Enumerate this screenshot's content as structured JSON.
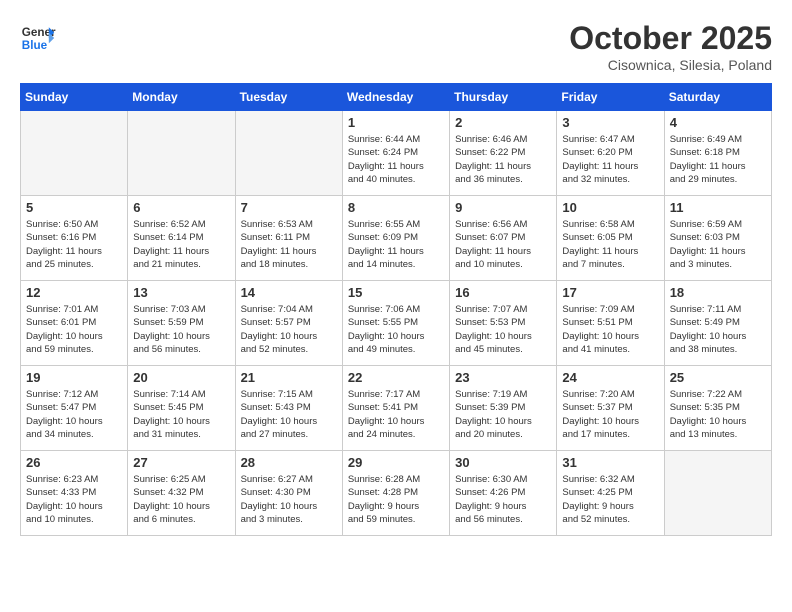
{
  "header": {
    "logo_line1": "General",
    "logo_line2": "Blue",
    "month": "October 2025",
    "location": "Cisownica, Silesia, Poland"
  },
  "days_of_week": [
    "Sunday",
    "Monday",
    "Tuesday",
    "Wednesday",
    "Thursday",
    "Friday",
    "Saturday"
  ],
  "weeks": [
    [
      {
        "day": "",
        "info": ""
      },
      {
        "day": "",
        "info": ""
      },
      {
        "day": "",
        "info": ""
      },
      {
        "day": "1",
        "info": "Sunrise: 6:44 AM\nSunset: 6:24 PM\nDaylight: 11 hours\nand 40 minutes."
      },
      {
        "day": "2",
        "info": "Sunrise: 6:46 AM\nSunset: 6:22 PM\nDaylight: 11 hours\nand 36 minutes."
      },
      {
        "day": "3",
        "info": "Sunrise: 6:47 AM\nSunset: 6:20 PM\nDaylight: 11 hours\nand 32 minutes."
      },
      {
        "day": "4",
        "info": "Sunrise: 6:49 AM\nSunset: 6:18 PM\nDaylight: 11 hours\nand 29 minutes."
      }
    ],
    [
      {
        "day": "5",
        "info": "Sunrise: 6:50 AM\nSunset: 6:16 PM\nDaylight: 11 hours\nand 25 minutes."
      },
      {
        "day": "6",
        "info": "Sunrise: 6:52 AM\nSunset: 6:14 PM\nDaylight: 11 hours\nand 21 minutes."
      },
      {
        "day": "7",
        "info": "Sunrise: 6:53 AM\nSunset: 6:11 PM\nDaylight: 11 hours\nand 18 minutes."
      },
      {
        "day": "8",
        "info": "Sunrise: 6:55 AM\nSunset: 6:09 PM\nDaylight: 11 hours\nand 14 minutes."
      },
      {
        "day": "9",
        "info": "Sunrise: 6:56 AM\nSunset: 6:07 PM\nDaylight: 11 hours\nand 10 minutes."
      },
      {
        "day": "10",
        "info": "Sunrise: 6:58 AM\nSunset: 6:05 PM\nDaylight: 11 hours\nand 7 minutes."
      },
      {
        "day": "11",
        "info": "Sunrise: 6:59 AM\nSunset: 6:03 PM\nDaylight: 11 hours\nand 3 minutes."
      }
    ],
    [
      {
        "day": "12",
        "info": "Sunrise: 7:01 AM\nSunset: 6:01 PM\nDaylight: 10 hours\nand 59 minutes."
      },
      {
        "day": "13",
        "info": "Sunrise: 7:03 AM\nSunset: 5:59 PM\nDaylight: 10 hours\nand 56 minutes."
      },
      {
        "day": "14",
        "info": "Sunrise: 7:04 AM\nSunset: 5:57 PM\nDaylight: 10 hours\nand 52 minutes."
      },
      {
        "day": "15",
        "info": "Sunrise: 7:06 AM\nSunset: 5:55 PM\nDaylight: 10 hours\nand 49 minutes."
      },
      {
        "day": "16",
        "info": "Sunrise: 7:07 AM\nSunset: 5:53 PM\nDaylight: 10 hours\nand 45 minutes."
      },
      {
        "day": "17",
        "info": "Sunrise: 7:09 AM\nSunset: 5:51 PM\nDaylight: 10 hours\nand 41 minutes."
      },
      {
        "day": "18",
        "info": "Sunrise: 7:11 AM\nSunset: 5:49 PM\nDaylight: 10 hours\nand 38 minutes."
      }
    ],
    [
      {
        "day": "19",
        "info": "Sunrise: 7:12 AM\nSunset: 5:47 PM\nDaylight: 10 hours\nand 34 minutes."
      },
      {
        "day": "20",
        "info": "Sunrise: 7:14 AM\nSunset: 5:45 PM\nDaylight: 10 hours\nand 31 minutes."
      },
      {
        "day": "21",
        "info": "Sunrise: 7:15 AM\nSunset: 5:43 PM\nDaylight: 10 hours\nand 27 minutes."
      },
      {
        "day": "22",
        "info": "Sunrise: 7:17 AM\nSunset: 5:41 PM\nDaylight: 10 hours\nand 24 minutes."
      },
      {
        "day": "23",
        "info": "Sunrise: 7:19 AM\nSunset: 5:39 PM\nDaylight: 10 hours\nand 20 minutes."
      },
      {
        "day": "24",
        "info": "Sunrise: 7:20 AM\nSunset: 5:37 PM\nDaylight: 10 hours\nand 17 minutes."
      },
      {
        "day": "25",
        "info": "Sunrise: 7:22 AM\nSunset: 5:35 PM\nDaylight: 10 hours\nand 13 minutes."
      }
    ],
    [
      {
        "day": "26",
        "info": "Sunrise: 6:23 AM\nSunset: 4:33 PM\nDaylight: 10 hours\nand 10 minutes."
      },
      {
        "day": "27",
        "info": "Sunrise: 6:25 AM\nSunset: 4:32 PM\nDaylight: 10 hours\nand 6 minutes."
      },
      {
        "day": "28",
        "info": "Sunrise: 6:27 AM\nSunset: 4:30 PM\nDaylight: 10 hours\nand 3 minutes."
      },
      {
        "day": "29",
        "info": "Sunrise: 6:28 AM\nSunset: 4:28 PM\nDaylight: 9 hours\nand 59 minutes."
      },
      {
        "day": "30",
        "info": "Sunrise: 6:30 AM\nSunset: 4:26 PM\nDaylight: 9 hours\nand 56 minutes."
      },
      {
        "day": "31",
        "info": "Sunrise: 6:32 AM\nSunset: 4:25 PM\nDaylight: 9 hours\nand 52 minutes."
      },
      {
        "day": "",
        "info": ""
      }
    ]
  ]
}
